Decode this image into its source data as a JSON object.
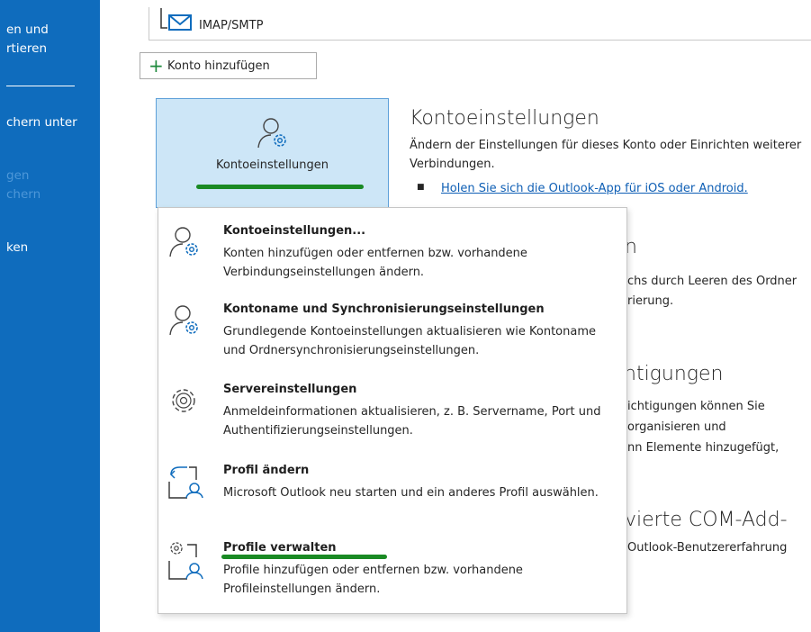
{
  "sidebar": {
    "items": [
      {
        "label": "en und"
      },
      {
        "label": "rtieren"
      },
      {
        "label": "chern unter"
      },
      {
        "label": "gen"
      },
      {
        "label": "chern"
      },
      {
        "label": "ken"
      }
    ]
  },
  "account_strip": {
    "label": "IMAP/SMTP"
  },
  "add_account": {
    "label": "Konto hinzufügen"
  },
  "tile": {
    "label": "Kontoeinstellungen"
  },
  "section1": {
    "title": "Kontoeinstellungen",
    "desc": "Ändern der Einstellungen für dieses Konto oder Einrichten weiterer Verbindungen.",
    "bullet": "■",
    "link": "Holen Sie sich die Outlook-App für iOS oder Android."
  },
  "background_fragments": {
    "b1": "n",
    "b2": "chs durch Leeren des Ordner",
    "b3": "rierung.",
    "b4": "htigungen",
    "b5": "ichtigungen können Sie",
    "b6": "organisieren und",
    "b7": "nn Elemente hinzugefügt,",
    "b8": "vierte COM-Add-",
    "b9": "Outlook-Benutzererfahrung"
  },
  "menu": {
    "items": [
      {
        "title": "Kontoeinstellungen...",
        "desc": "Konten hinzufügen oder entfernen bzw. vorhandene Verbindungseinstellungen ändern.",
        "icon": "account-settings-icon"
      },
      {
        "title": "Kontoname und Synchronisierungseinstellungen",
        "desc": "Grundlegende Kontoeinstellungen aktualisieren wie Kontoname und Ordnersynchronisierungseinstellungen.",
        "icon": "account-settings-icon"
      },
      {
        "title": "Servereinstellungen",
        "desc": "Anmeldeinformationen aktualisieren, z. B. Servername, Port und Authentifizierungseinstellungen.",
        "icon": "server-gear-icon"
      },
      {
        "title": "Profil ändern",
        "desc": "Microsoft Outlook neu starten und ein anderes Profil auswählen.",
        "icon": "change-profile-icon"
      },
      {
        "title": "Profile verwalten",
        "desc": "Profile hinzufügen oder entfernen bzw. vorhandene Profileinstellungen ändern.",
        "icon": "manage-profiles-icon"
      }
    ]
  },
  "colors": {
    "sidebar": "#0f6cbd",
    "tile_bg": "#cde6f7",
    "highlight_line": "#1a8a24",
    "link": "#0f5fb5"
  }
}
